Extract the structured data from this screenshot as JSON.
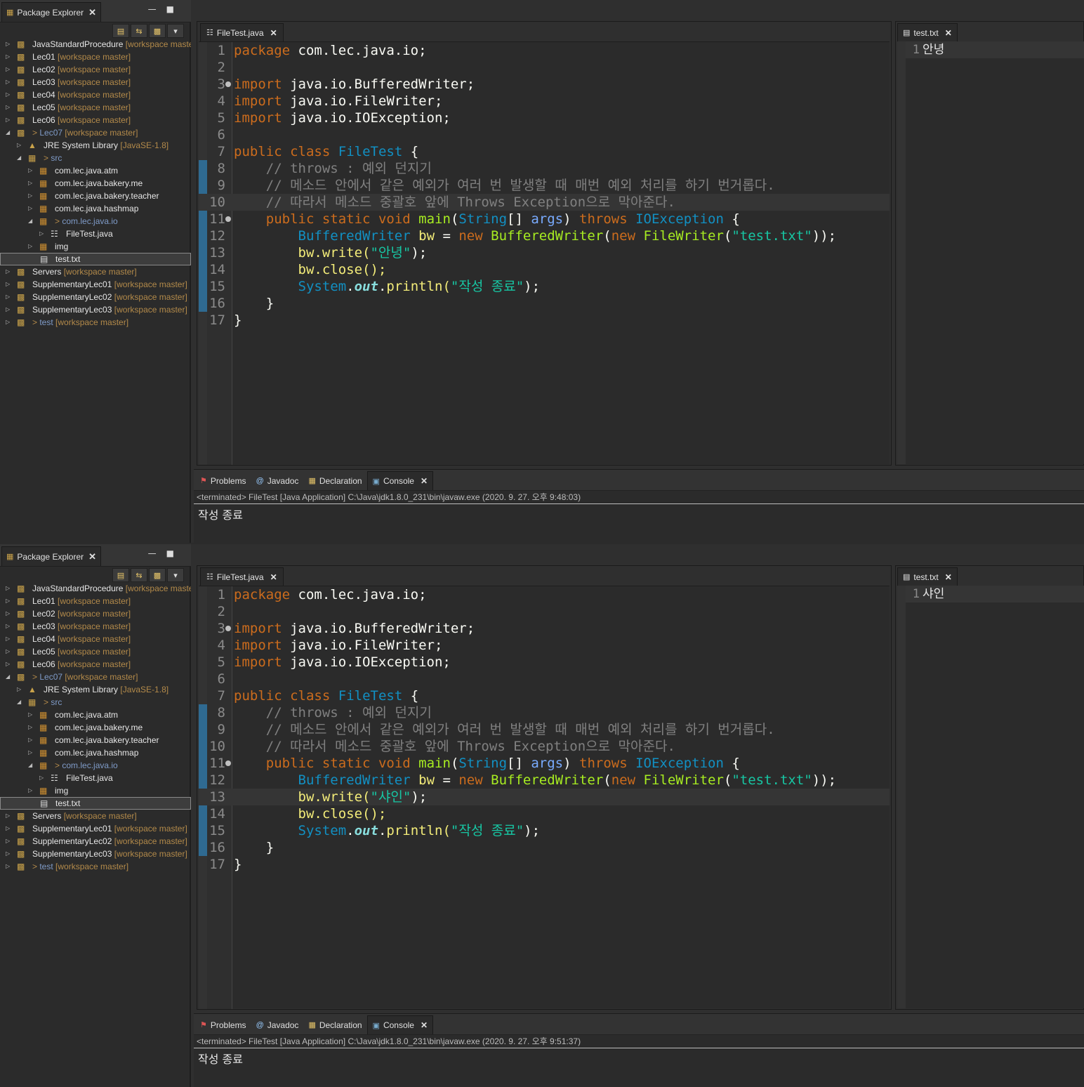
{
  "panels": [
    {
      "explorer": {
        "tab_label": "Package Explorer",
        "items": [
          {
            "label": "JavaStandardProcedure",
            "tag": "[workspace maste",
            "depth": 0,
            "expanded": false,
            "prefix": ""
          },
          {
            "label": "Lec01",
            "tag": "[workspace master]",
            "depth": 0,
            "expanded": false,
            "prefix": ""
          },
          {
            "label": "Lec02",
            "tag": "[workspace master]",
            "depth": 0,
            "expanded": false,
            "prefix": ""
          },
          {
            "label": "Lec03",
            "tag": "[workspace master]",
            "depth": 0,
            "expanded": false,
            "prefix": ""
          },
          {
            "label": "Lec04",
            "tag": "[workspace master]",
            "depth": 0,
            "expanded": false,
            "prefix": ""
          },
          {
            "label": "Lec05",
            "tag": "[workspace master]",
            "depth": 0,
            "expanded": false,
            "prefix": ""
          },
          {
            "label": "Lec06",
            "tag": "[workspace master]",
            "depth": 0,
            "expanded": false,
            "prefix": ""
          },
          {
            "label": "Lec07",
            "tag": "[workspace master]",
            "depth": 0,
            "expanded": true,
            "prefix": "> "
          },
          {
            "label": "JRE System Library",
            "tag": "[JavaSE-1.8]",
            "depth": 1,
            "expanded": false,
            "prefix": ""
          },
          {
            "label": "src",
            "tag": "",
            "depth": 1,
            "expanded": true,
            "prefix": "> "
          },
          {
            "label": "com.lec.java.atm",
            "tag": "",
            "depth": 2,
            "expanded": false,
            "prefix": ""
          },
          {
            "label": "com.lec.java.bakery.me",
            "tag": "",
            "depth": 2,
            "expanded": false,
            "prefix": ""
          },
          {
            "label": "com.lec.java.bakery.teacher",
            "tag": "",
            "depth": 2,
            "expanded": false,
            "prefix": ""
          },
          {
            "label": "com.lec.java.hashmap",
            "tag": "",
            "depth": 2,
            "expanded": false,
            "prefix": ""
          },
          {
            "label": "com.lec.java.io",
            "tag": "",
            "depth": 2,
            "expanded": true,
            "prefix": "> "
          },
          {
            "label": "FileTest.java",
            "tag": "",
            "depth": 3,
            "expanded": false,
            "prefix": ""
          },
          {
            "label": "img",
            "tag": "",
            "depth": 2,
            "expanded": false,
            "prefix": ""
          },
          {
            "label": "test.txt",
            "tag": "",
            "depth": 2,
            "expanded": false,
            "prefix": ""
          },
          {
            "label": "Servers",
            "tag": "[workspace master]",
            "depth": 0,
            "expanded": false,
            "prefix": ""
          },
          {
            "label": "SupplementaryLec01",
            "tag": "[workspace master]",
            "depth": 0,
            "expanded": false,
            "prefix": ""
          },
          {
            "label": "SupplementaryLec02",
            "tag": "[workspace master]",
            "depth": 0,
            "expanded": false,
            "prefix": ""
          },
          {
            "label": "SupplementaryLec03",
            "tag": "[workspace master]",
            "depth": 0,
            "expanded": false,
            "prefix": ""
          },
          {
            "label": "test",
            "tag": "[workspace master]",
            "depth": 0,
            "expanded": false,
            "prefix": "> "
          }
        ]
      },
      "editor": {
        "tab_label": "FileTest.java",
        "write_arg": "안녕",
        "current_line": 10
      },
      "textfile": {
        "tab_label": "test.txt",
        "line_number": "1",
        "content": "안녕"
      },
      "console": {
        "tabs": [
          "Problems",
          "Javadoc",
          "Declaration",
          "Console"
        ],
        "header": "<terminated> FileTest [Java Application] C:\\Java\\jdk1.8.0_231\\bin\\javaw.exe (2020. 9. 27. 오후 9:48:03)",
        "output": "작성 종료"
      }
    },
    {
      "explorer": {
        "tab_label": "Package Explorer"
      },
      "editor": {
        "tab_label": "FileTest.java",
        "write_arg": "샤인",
        "current_line": 13
      },
      "textfile": {
        "tab_label": "test.txt",
        "line_number": "1",
        "content": "샤인"
      },
      "console": {
        "tabs": [
          "Problems",
          "Javadoc",
          "Declaration",
          "Console"
        ],
        "header": "<terminated> FileTest [Java Application] C:\\Java\\jdk1.8.0_231\\bin\\javaw.exe (2020. 9. 27. 오후 9:51:37)",
        "output": "작성 종료"
      }
    }
  ],
  "code": {
    "line_numbers": [
      "1",
      "2",
      "3",
      "4",
      "5",
      "6",
      "7",
      "8",
      "9",
      "10",
      "11",
      "12",
      "13",
      "14",
      "15",
      "16",
      "17"
    ],
    "package_kw": "package",
    "package_name": "com.lec.java.io;",
    "import_kw": "import",
    "imports": [
      "java.io.BufferedWriter;",
      "java.io.FileWriter;",
      "java.io.IOException;"
    ],
    "class_decl": {
      "public": "public",
      "class": "class",
      "name": "FileTest",
      "brace": "{"
    },
    "comments": [
      "// throws : 예외 던지기",
      "// 메소드 안에서 같은 예외가 여러 번 발생할 때 매번 예외 처리를 하기 번거롭다.",
      "// 따라서 메소드 중괄호 앞에 Throws Exception으로 막아준다."
    ],
    "main_sig": {
      "public": "public",
      "static": "static",
      "void": "void",
      "main": "main",
      "string": "String",
      "args": "args",
      "throws": "throws",
      "exc": "IOException"
    },
    "line12": {
      "type": "BufferedWriter",
      "var": "bw",
      "new": "new",
      "ctor": "BufferedWriter",
      "new2": "new",
      "ctor2": "FileWriter",
      "file": "\"test.txt\""
    },
    "write_call": "bw.write(",
    "close_call": "bw.close();",
    "println": {
      "system": "System",
      "out": "out",
      "method": "println(",
      "arg": "\"작성 종료\""
    }
  },
  "colors": {
    "keyword": "#cc6c1d",
    "type": "#1290c3",
    "method": "#a7ec21",
    "string": "#17c6a3",
    "comment": "#808080",
    "variable": "#f3ec79"
  },
  "icons": [
    "package-explorer-icon",
    "collapse-all-icon",
    "link-editor-icon",
    "view-menu-icon",
    "project-icon",
    "jre-library-icon",
    "source-folder-icon",
    "package-icon",
    "java-file-icon",
    "text-file-icon",
    "problems-icon",
    "javadoc-icon",
    "declaration-icon",
    "console-icon",
    "close-icon"
  ]
}
